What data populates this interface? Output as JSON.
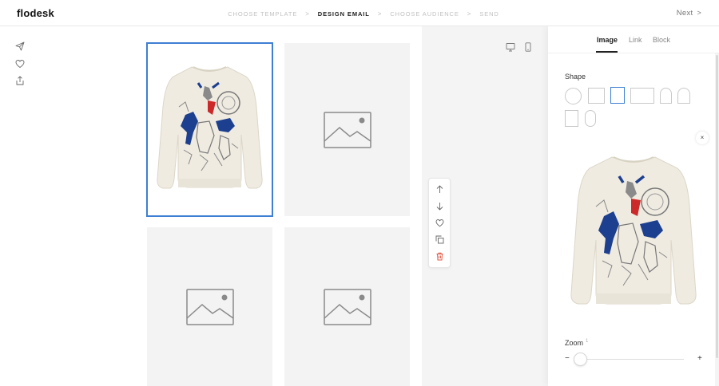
{
  "app": {
    "logo": "flodesk"
  },
  "steps": [
    {
      "label": "CHOOSE TEMPLATE",
      "active": false
    },
    {
      "label": "DESIGN EMAIL",
      "active": true
    },
    {
      "label": "CHOOSE AUDIENCE",
      "active": false
    },
    {
      "label": "SEND",
      "active": false
    }
  ],
  "step_separator": ">",
  "header": {
    "next_label": "Next",
    "next_icon": ">"
  },
  "left_rail": {
    "icons": [
      "send-icon",
      "heart-icon",
      "share-icon"
    ]
  },
  "canvas": {
    "tiles": [
      {
        "content": "sweater-image",
        "selected": true
      },
      {
        "content": "image-placeholder",
        "selected": false
      },
      {
        "content": "image-placeholder",
        "selected": false
      },
      {
        "content": "image-placeholder",
        "selected": false
      }
    ]
  },
  "floating_toolbar": {
    "icons": [
      "arrow-up-icon",
      "arrow-down-icon",
      "heart-icon",
      "duplicate-icon",
      "trash-icon"
    ]
  },
  "device_toggle": {
    "icons": [
      "desktop-icon",
      "mobile-icon"
    ]
  },
  "panel": {
    "tabs": [
      {
        "label": "Image",
        "active": true
      },
      {
        "label": "Link",
        "active": false
      },
      {
        "label": "Block",
        "active": false
      }
    ],
    "shape_label": "Shape",
    "shapes": [
      "circle",
      "square",
      "portrait",
      "landscape",
      "arch",
      "arch-wide",
      "rectangle-tall",
      "oval-tall"
    ],
    "selected_shape": "portrait",
    "close_label": "×",
    "zoom": {
      "label": "Zoom",
      "value": "1",
      "minus": "−",
      "plus": "+",
      "level": 0
    }
  },
  "colors": {
    "accent": "#3d7fd3",
    "danger": "#e0533d",
    "placeholder_bg": "#f3f3f3"
  }
}
